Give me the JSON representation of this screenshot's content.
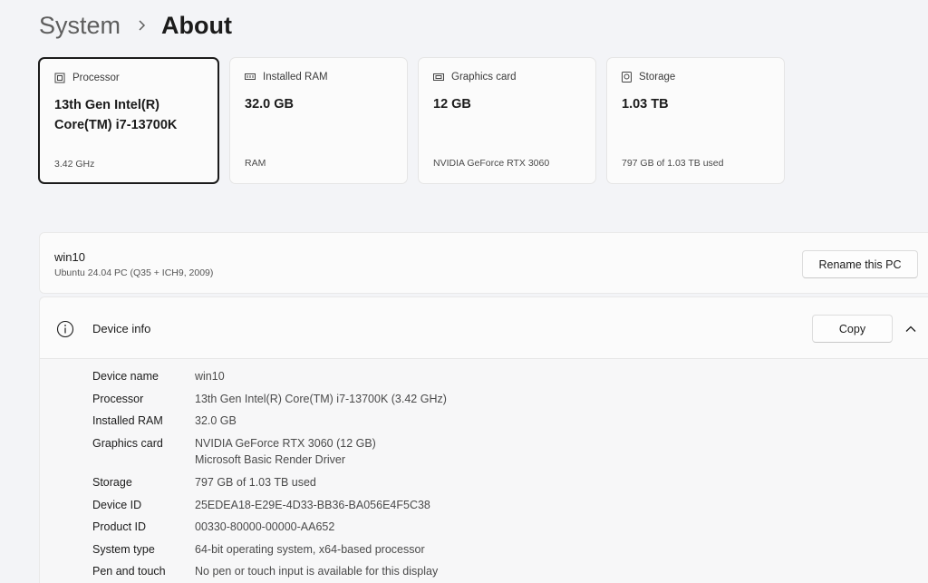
{
  "breadcrumb": {
    "parent": "System",
    "current": "About"
  },
  "cards": [
    {
      "label": "Processor",
      "value": "13th Gen Intel(R) Core(TM) i7-13700K",
      "sub": "3.42 GHz",
      "icon": "processor-icon"
    },
    {
      "label": "Installed RAM",
      "value": "32.0 GB",
      "sub": "RAM",
      "icon": "ram-icon"
    },
    {
      "label": "Graphics card",
      "value": "12 GB",
      "sub": "NVIDIA GeForce RTX 3060",
      "icon": "graphics-card-icon"
    },
    {
      "label": "Storage",
      "value": "1.03 TB",
      "sub": "797 GB of 1.03 TB used",
      "icon": "storage-icon"
    }
  ],
  "pc": {
    "name": "win10",
    "description": "Ubuntu 24.04 PC (Q35 + ICH9, 2009)",
    "rename_label": "Rename this PC"
  },
  "device_info": {
    "title": "Device info",
    "copy_label": "Copy",
    "rows": [
      {
        "key": "Device name",
        "value": "win10"
      },
      {
        "key": "Processor",
        "value": "13th Gen Intel(R) Core(TM) i7-13700K (3.42 GHz)"
      },
      {
        "key": "Installed RAM",
        "value": "32.0 GB"
      },
      {
        "key": "Graphics card",
        "value": "NVIDIA GeForce RTX 3060 (12 GB)",
        "value2": "Microsoft Basic Render Driver"
      },
      {
        "key": "Storage",
        "value": "797 GB of 1.03 TB used"
      },
      {
        "key": "Device ID",
        "value": "25EDEA18-E29E-4D33-BB36-BA056E4F5C38"
      },
      {
        "key": "Product ID",
        "value": "00330-80000-00000-AA652"
      },
      {
        "key": "System type",
        "value": "64-bit operating system, x64-based processor"
      },
      {
        "key": "Pen and touch",
        "value": "No pen or touch input is available for this display"
      }
    ]
  }
}
